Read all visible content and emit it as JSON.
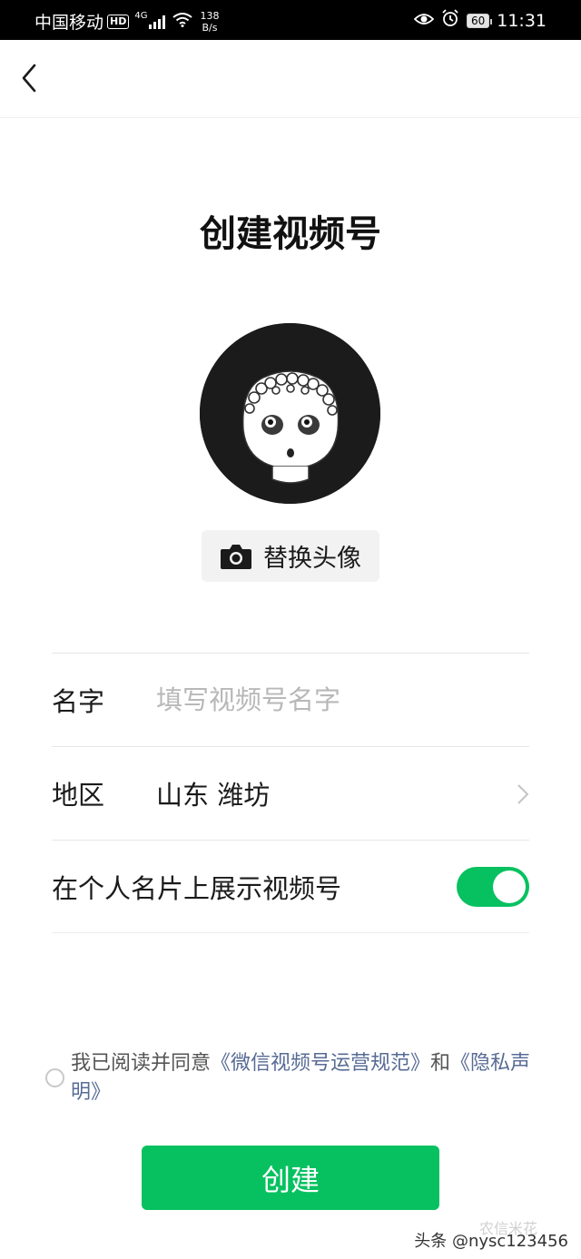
{
  "status_bar": {
    "carrier": "中国移动",
    "hd": "HD",
    "network": "4G",
    "speed_value": "138",
    "speed_unit": "B/s",
    "battery": "60",
    "time": "11:31"
  },
  "header": {
    "title": "创建视频号"
  },
  "avatar": {
    "replace_label": "替换头像"
  },
  "form": {
    "name_label": "名字",
    "name_placeholder": "填写视频号名字",
    "name_value": "",
    "region_label": "地区",
    "region_value": "山东 潍坊",
    "show_label": "在个人名片上展示视频号",
    "show_enabled": true
  },
  "agreement": {
    "prefix": "我已阅读并同意",
    "link1": "《微信视频号运营规范》",
    "and": "和",
    "link2": "《隐私声明》",
    "checked": false
  },
  "actions": {
    "create_label": "创建"
  },
  "watermark": {
    "text": "头条 @nysc123456",
    "faint": "农信米花"
  },
  "colors": {
    "accent": "#07c160",
    "link": "#576b95"
  }
}
